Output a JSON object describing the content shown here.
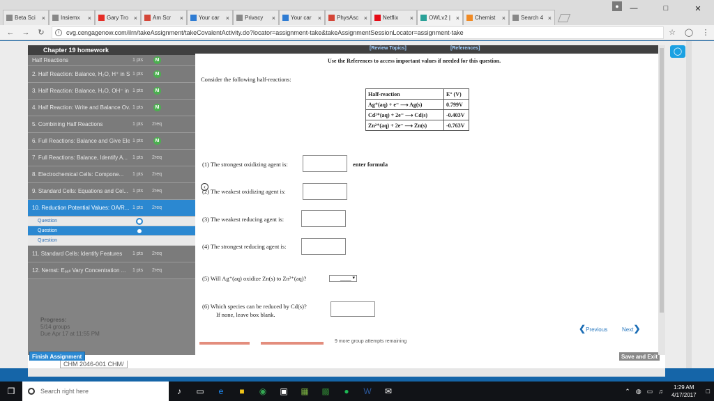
{
  "browser": {
    "tabs": [
      {
        "title": "Beta Sci",
        "icon": "doc-icon",
        "color": "#888888"
      },
      {
        "title": "Insiemx",
        "icon": "doc-icon",
        "color": "#888888"
      },
      {
        "title": "Gary Tro",
        "icon": "youtube-icon",
        "color": "#e52d27"
      },
      {
        "title": "Am Scr",
        "icon": "gmail-icon",
        "color": "#d44638"
      },
      {
        "title": "Your car",
        "icon": "w-icon",
        "color": "#2f7cd3"
      },
      {
        "title": "Privacy",
        "icon": "doc-icon",
        "color": "#888888"
      },
      {
        "title": "Your car",
        "icon": "w-icon",
        "color": "#2f7cd3"
      },
      {
        "title": "PhysAsc",
        "icon": "gmail-icon",
        "color": "#d44638"
      },
      {
        "title": "Netflix",
        "icon": "netflix-icon",
        "color": "#e50914"
      },
      {
        "title": "OWLv2 |",
        "icon": "loading-icon",
        "color": "#2aa198"
      },
      {
        "title": "Chemist",
        "icon": "c-icon",
        "color": "#f08a24"
      },
      {
        "title": "Search 4",
        "icon": "doc-icon",
        "color": "#888888"
      }
    ],
    "url": "cvg.cengagenow.com/ilrn/takeAssignment/takeCovalentActivity.do?locator=assignment-take&takeAssignmentSessionLocator=assignment-take"
  },
  "sidebar": {
    "title": "Chapter 19 homework",
    "items": [
      {
        "label": "Half Reactions",
        "pts": "1 pts",
        "status": "M"
      },
      {
        "label": "2. Half Reaction: Balance, H₂O, H⁺ in S...",
        "pts": "1 pts",
        "status": "M"
      },
      {
        "label": "3. Half Reaction: Balance, H₂O, OH⁻ in ...",
        "pts": "1 pts",
        "status": "M"
      },
      {
        "label": "4. Half Reaction: Write and Balance Ov...",
        "pts": "1 pts",
        "status": "M"
      },
      {
        "label": "5. Combining Half Reactions",
        "pts": "1 pts",
        "status": "2req"
      },
      {
        "label": "6. Full Reactions: Balance and Give Ele...",
        "pts": "1 pts",
        "status": "M"
      },
      {
        "label": "7. Full Reactions: Balance, Identify A...",
        "pts": "1 pts",
        "status": "2req"
      },
      {
        "label": "8. Electrochemical Cells: Compone...",
        "pts": "1 pts",
        "status": "2req"
      },
      {
        "label": "9. Standard Cells: Equations and Cel...",
        "pts": "1 pts",
        "status": "2req"
      },
      {
        "label": "10. Reduction Potential Values: OA/R...",
        "pts": "1 pts",
        "status": "2req"
      }
    ],
    "subs": [
      "Question",
      "Question",
      "Question"
    ],
    "items2": [
      {
        "label": "11. Standard Cells: Identify Features",
        "pts": "1 pts",
        "status": "2req"
      },
      {
        "label": "12. Nernst: Eₑₑₗₗ Vary Concentration ...",
        "pts": "1 pts",
        "status": "2req"
      }
    ],
    "progress_label": "Progress:",
    "progress_value": "5/14 groups",
    "due": "Due Apr 17 at 11:55 PM",
    "finish": "Finish Assignment"
  },
  "content": {
    "review_link": "[Review Topics]",
    "refs_link": "[References]",
    "ref_note": "Use the References to access important values if needed for this question.",
    "intro": "Consider the following half-reactions:",
    "table": {
      "headers": [
        "Half-reaction",
        "E° (V)"
      ],
      "rows": [
        [
          "Ag⁺(aq) + e⁻ ⟶ Ag(s)",
          "0.799V"
        ],
        [
          "Cd²⁺(aq) + 2e⁻ ⟶ Cd(s)",
          "-0.403V"
        ],
        [
          "Zn²⁺(aq) + 2e⁻ ⟶ Zn(s)",
          "-0.763V"
        ]
      ]
    },
    "q1": "(1) The strongest oxidizing agent is:",
    "q1_hint": "enter formula",
    "q2": "(2) The weakest oxidizing agent is:",
    "q3": "(3) The weakest reducing agent is:",
    "q4": "(4) The strongest reducing agent is:",
    "q5": "(5) Will Ag⁺(aq) oxidize Zn(s) to Zn²⁺(aq)?",
    "q5_select": "____ ▾",
    "q6": "(6) Which species can be reduced by Cd(s)?",
    "q6b": "If none, leave box blank.",
    "previous": "Previous",
    "next": "Next",
    "remaining": "9 more group attempts remaining",
    "save": "Save and Exit",
    "bottom_peek": "CHM 2046-001 CHM/"
  },
  "taskbar": {
    "search": "Search right here",
    "time": "1:29 AM",
    "date": "4/17/2017"
  }
}
